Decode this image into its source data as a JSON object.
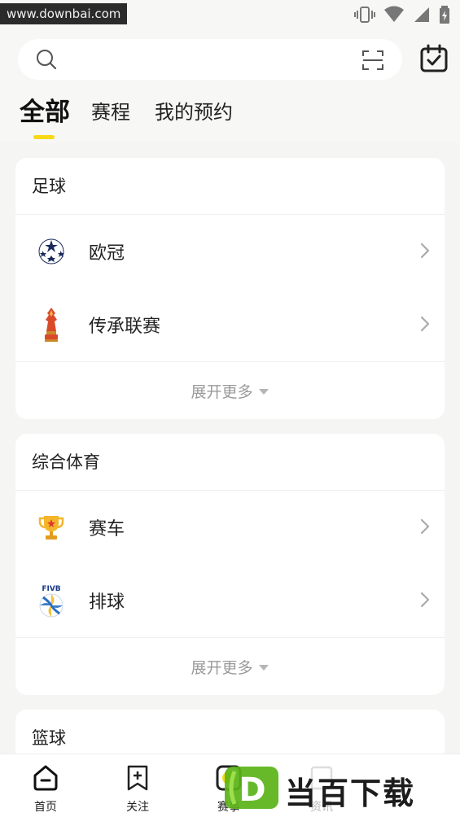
{
  "status_bar": {
    "watermark_url": "www.downbai.com"
  },
  "header": {
    "search": {
      "placeholder": ""
    },
    "tabs": [
      {
        "label": "全部",
        "active": true
      },
      {
        "label": "赛程",
        "active": false
      },
      {
        "label": "我的预约",
        "active": false
      }
    ]
  },
  "sections": [
    {
      "title": "足球",
      "items": [
        {
          "label": "欧冠",
          "icon": "champions-league-icon"
        },
        {
          "label": "传承联赛",
          "icon": "league-trophy-icon"
        }
      ],
      "expand_label": "展开更多"
    },
    {
      "title": "综合体育",
      "items": [
        {
          "label": "赛车",
          "icon": "trophy-icon"
        },
        {
          "label": "排球",
          "icon": "volleyball-fivb-icon"
        }
      ],
      "expand_label": "展开更多"
    },
    {
      "title": "篮球"
    }
  ],
  "icon_texts": {
    "fivb": "FIVB"
  },
  "bottom_nav": {
    "items": [
      {
        "label": "首页",
        "icon": "home-icon"
      },
      {
        "label": "关注",
        "icon": "follow-icon"
      },
      {
        "label": "赛事",
        "icon": "events-icon"
      },
      {
        "label": "资讯",
        "icon": "news-icon"
      }
    ]
  },
  "brand_watermark": {
    "text": "当百下载",
    "letter": "D"
  },
  "colors": {
    "accent_yellow": "#f7d917",
    "background": "#f5f5f4",
    "card": "#ffffff",
    "muted_text": "#9a9a9a"
  }
}
